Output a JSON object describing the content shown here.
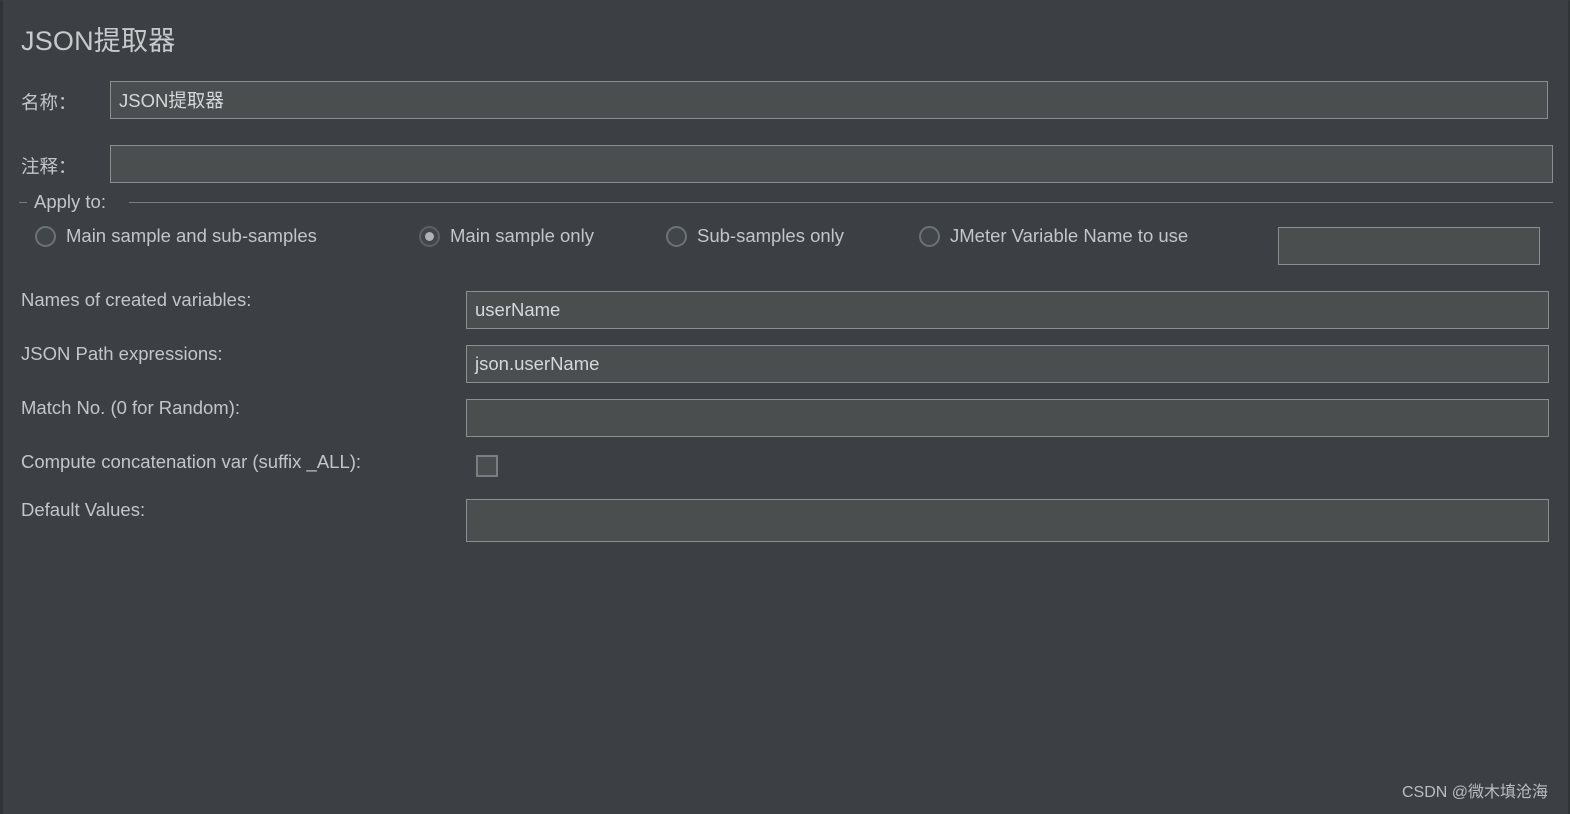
{
  "panel": {
    "title": "JSON提取器"
  },
  "form": {
    "name_label": "名称：",
    "name_value": "JSON提取器",
    "comment_label": "注释：",
    "comment_value": ""
  },
  "apply_to": {
    "legend": "Apply to:",
    "options": [
      {
        "label": "Main sample and sub-samples",
        "selected": false
      },
      {
        "label": "Main sample only",
        "selected": true
      },
      {
        "label": "Sub-samples only",
        "selected": false
      },
      {
        "label": "JMeter Variable Name to use",
        "selected": false
      }
    ],
    "variable_name_value": ""
  },
  "fields": {
    "names_label": "Names of created variables:",
    "names_value": "userName",
    "jsonpath_label": "JSON Path expressions:",
    "jsonpath_value": "json.userName",
    "matchno_label": "Match No. (0 for Random):",
    "matchno_value": "",
    "concat_label": "Compute concatenation var (suffix _ALL):",
    "concat_checked": false,
    "default_label": "Default Values:",
    "default_value": ""
  },
  "watermark": {
    "text": "CSDN @微木填沧海"
  },
  "colors": {
    "background": "#3c4044",
    "field_fill": "#4a4e4e",
    "field_border": "#8b8f90",
    "text": "#c2c6c9"
  }
}
